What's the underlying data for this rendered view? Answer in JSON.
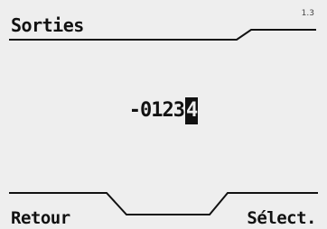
{
  "header": {
    "title": "Sorties",
    "page_indicator": "1.3"
  },
  "main": {
    "value": "-0123",
    "cursor_digit": "4"
  },
  "footer": {
    "left_softkey": "Retour",
    "right_softkey": "Sélect."
  },
  "colors": {
    "background": "#eeeeee",
    "foreground": "#111111"
  }
}
